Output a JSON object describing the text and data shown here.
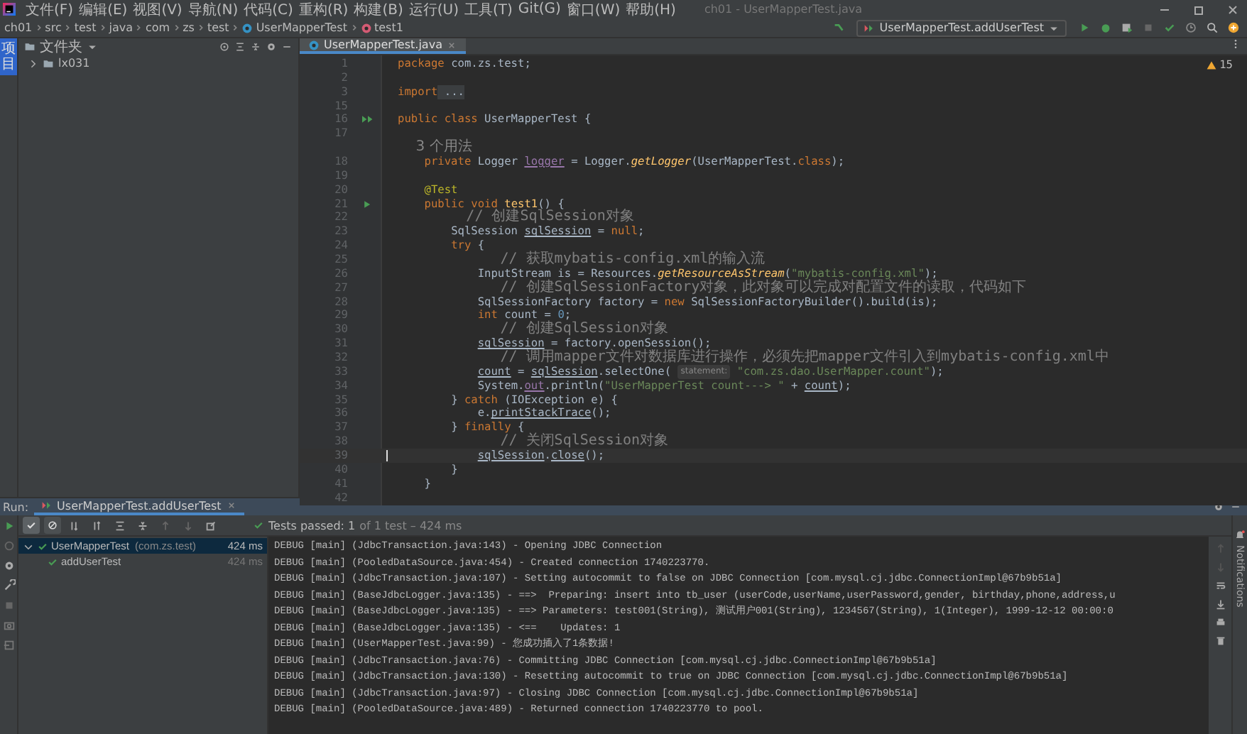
{
  "menubar": {
    "items": [
      "文件(F)",
      "编辑(E)",
      "视图(V)",
      "导航(N)",
      "代码(C)",
      "重构(R)",
      "构建(B)",
      "运行(U)",
      "工具(T)",
      "Git(G)",
      "窗口(W)",
      "帮助(H)"
    ],
    "title": "ch01 - UserMapperTest.java"
  },
  "breadcrumbs": [
    {
      "label": "ch01",
      "kind": "folder"
    },
    {
      "label": "src",
      "kind": "folder"
    },
    {
      "label": "test",
      "kind": "folder"
    },
    {
      "label": "java",
      "kind": "folder"
    },
    {
      "label": "com",
      "kind": "folder"
    },
    {
      "label": "zs",
      "kind": "folder"
    },
    {
      "label": "test",
      "kind": "folder"
    },
    {
      "label": "UserMapperTest",
      "kind": "class"
    },
    {
      "label": "test1",
      "kind": "method"
    }
  ],
  "run_config": "UserMapperTest.addUserTest",
  "side_tool": {
    "label": "项目",
    "selected": true
  },
  "project": {
    "title": "文件夹",
    "tree": [
      {
        "label": "lx031",
        "expanded": false
      }
    ]
  },
  "editor": {
    "tabs": [
      {
        "label": "UserMapperTest.java",
        "selected": true
      }
    ],
    "warnings": "15",
    "lines": [
      {
        "num": "1",
        "tokens": [
          {
            "t": "package",
            "kind": "kw"
          },
          {
            "t": " com.zs.test;",
            "kind": "plain"
          }
        ]
      },
      {
        "num": "2"
      },
      {
        "num": "3",
        "tokens": [
          {
            "t": "import",
            "kind": "kw"
          },
          {
            "t": " ...",
            "kind": "fold"
          }
        ]
      },
      {
        "num": "15"
      },
      {
        "num": "16",
        "kind": "run-class",
        "tokens": [
          {
            "t": "public class ",
            "kind": "kw"
          },
          {
            "t": "UserMapperTest {",
            "kind": "plain"
          }
        ]
      },
      {
        "num": "17"
      },
      {
        "tokens": [
          {
            "t": "    3 个用法",
            "kind": "usage"
          }
        ]
      },
      {
        "num": "18",
        "tokens": [
          {
            "t": "    private ",
            "kind": "kw"
          },
          {
            "t": "Logger ",
            "kind": "plain"
          },
          {
            "t": "logger",
            "kind": "field"
          },
          {
            "t": " = Logger.",
            "kind": "plain"
          },
          {
            "t": "getLogger",
            "kind": "static"
          },
          {
            "t": "(UserMapperTest.",
            "kind": "plain"
          },
          {
            "t": "class",
            "kind": "kw"
          },
          {
            "t": ");",
            "kind": "plain"
          }
        ]
      },
      {
        "num": "19"
      },
      {
        "num": "20",
        "tokens": [
          {
            "t": "    @Test",
            "kind": "ann"
          }
        ]
      },
      {
        "num": "21",
        "kind": "run",
        "tokens": [
          {
            "t": "    public void ",
            "kind": "kw"
          },
          {
            "t": "test1",
            "kind": "method"
          },
          {
            "t": "() {",
            "kind": "plain"
          }
        ]
      },
      {
        "num": "22",
        "tokens": [
          {
            "t": "        // 创建SqlSession对象",
            "kind": "comment"
          }
        ]
      },
      {
        "num": "23",
        "tokens": [
          {
            "t": "        SqlSession ",
            "kind": "plain"
          },
          {
            "t": "sqlSession",
            "kind": "var"
          },
          {
            "t": " = ",
            "kind": "plain"
          },
          {
            "t": "null",
            "kind": "kw"
          },
          {
            "t": ";",
            "kind": "plain"
          }
        ]
      },
      {
        "num": "24",
        "tokens": [
          {
            "t": "        try ",
            "kind": "kw"
          },
          {
            "t": "{",
            "kind": "plain"
          }
        ]
      },
      {
        "num": "25",
        "tokens": [
          {
            "t": "            // 获取mybatis-config.xml的输入流",
            "kind": "comment"
          }
        ]
      },
      {
        "num": "26",
        "tokens": [
          {
            "t": "            InputStream is = Resources.",
            "kind": "plain"
          },
          {
            "t": "getResourceAsStream",
            "kind": "static"
          },
          {
            "t": "(",
            "kind": "plain"
          },
          {
            "t": "\"mybatis-config.xml\"",
            "kind": "str"
          },
          {
            "t": ");",
            "kind": "plain"
          }
        ]
      },
      {
        "num": "27",
        "tokens": [
          {
            "t": "            // 创建SqlSessionFactory对象，此对象可以完成对配置文件的读取，代码如下",
            "kind": "comment"
          }
        ]
      },
      {
        "num": "28",
        "tokens": [
          {
            "t": "            SqlSessionFactory factory = ",
            "kind": "plain"
          },
          {
            "t": "new ",
            "kind": "kw"
          },
          {
            "t": "SqlSessionFactoryBuilder().build(is);",
            "kind": "plain"
          }
        ]
      },
      {
        "num": "29",
        "tokens": [
          {
            "t": "            int ",
            "kind": "kw"
          },
          {
            "t": "count = ",
            "kind": "plain"
          },
          {
            "t": "0",
            "kind": "number"
          },
          {
            "t": ";",
            "kind": "plain"
          }
        ]
      },
      {
        "num": "30",
        "tokens": [
          {
            "t": "            // 创建SqlSession对象",
            "kind": "comment"
          }
        ]
      },
      {
        "num": "31",
        "tokens": [
          {
            "t": "            sqlSession",
            "kind": "var"
          },
          {
            "t": " = factory.openSession();",
            "kind": "plain"
          }
        ]
      },
      {
        "num": "32",
        "tokens": [
          {
            "t": "            // 调用mapper文件对数据库进行操作，必须先把mapper文件引入到mybatis-config.xml中",
            "kind": "comment"
          }
        ]
      },
      {
        "num": "33",
        "tokens": [
          {
            "t": "            count",
            "kind": "var"
          },
          {
            "t": " = ",
            "kind": "plain"
          },
          {
            "t": "sqlSession",
            "kind": "var"
          },
          {
            "t": ".selectOne( ",
            "kind": "plain"
          },
          {
            "t": "statement:",
            "kind": "hint"
          },
          {
            "t": " \"com.zs.dao.UserMapper.count\"",
            "kind": "str"
          },
          {
            "t": ");",
            "kind": "plain"
          }
        ]
      },
      {
        "num": "34",
        "tokens": [
          {
            "t": "            System.",
            "kind": "plain"
          },
          {
            "t": "out",
            "kind": "field"
          },
          {
            "t": ".println(",
            "kind": "plain"
          },
          {
            "t": "\"UserMapperTest count---> \"",
            "kind": "str"
          },
          {
            "t": " + ",
            "kind": "plain"
          },
          {
            "t": "count",
            "kind": "var"
          },
          {
            "t": ");",
            "kind": "plain"
          }
        ]
      },
      {
        "num": "35",
        "tokens": [
          {
            "t": "        } ",
            "kind": "plain"
          },
          {
            "t": "catch ",
            "kind": "kw"
          },
          {
            "t": "(IOException e) {",
            "kind": "plain"
          }
        ]
      },
      {
        "num": "36",
        "tokens": [
          {
            "t": "            e.",
            "kind": "plain"
          },
          {
            "t": "printStackTrace",
            "kind": "var"
          },
          {
            "t": "();",
            "kind": "plain"
          }
        ]
      },
      {
        "num": "37",
        "tokens": [
          {
            "t": "        } ",
            "kind": "plain"
          },
          {
            "t": "finally ",
            "kind": "kw"
          },
          {
            "t": "{",
            "kind": "plain"
          }
        ]
      },
      {
        "num": "38",
        "tokens": [
          {
            "t": "            // 关闭SqlSession对象",
            "kind": "comment"
          }
        ]
      },
      {
        "num": "39",
        "current": true,
        "tokens": [
          {
            "t": "            sqlSession",
            "kind": "var"
          },
          {
            "t": ".",
            "kind": "plain"
          },
          {
            "t": "close",
            "kind": "var"
          },
          {
            "t": "();",
            "kind": "plain"
          }
        ]
      },
      {
        "num": "40",
        "tokens": [
          {
            "t": "        }",
            "kind": "plain"
          }
        ]
      },
      {
        "num": "41",
        "tokens": [
          {
            "t": "    }",
            "kind": "plain"
          }
        ]
      },
      {
        "num": "42"
      }
    ]
  },
  "run": {
    "label": "Run:",
    "tabs": [
      {
        "label": "UserMapperTest.addUserTest",
        "selected": true
      }
    ],
    "status": {
      "label": "Tests passed: 1",
      "detail": "of 1 test – 424 ms"
    },
    "tree": [
      {
        "label": "UserMapperTest",
        "package": "(com.zs.test)",
        "time": "424 ms",
        "passed": true,
        "selected": true,
        "children": [
          {
            "label": "addUserTest",
            "time": "424 ms",
            "passed": true,
            "selected": false
          }
        ]
      }
    ],
    "console": [
      "DEBUG [main] (JdbcTransaction.java:143) - Opening JDBC Connection",
      "DEBUG [main] (PooledDataSource.java:454) - Created connection 1740223770.",
      "DEBUG [main] (JdbcTransaction.java:107) - Setting autocommit to false on JDBC Connection [com.mysql.cj.jdbc.ConnectionImpl@67b9b51a]",
      "DEBUG [main] (BaseJdbcLogger.java:135) - ==>  Preparing: insert into tb_user (userCode,userName,userPassword,gender, birthday,phone,address,u",
      "DEBUG [main] (BaseJdbcLogger.java:135) - ==> Parameters: test001(String), 测试用户001(String), 1234567(String), 1(Integer), 1999-12-12 00:00:0",
      "DEBUG [main] (BaseJdbcLogger.java:135) - <==    Updates: 1",
      "DEBUG [main] (UserMapperTest.java:99) - 您成功插入了1条数据!",
      "DEBUG [main] (JdbcTransaction.java:76) - Committing JDBC Connection [com.mysql.cj.jdbc.ConnectionImpl@67b9b51a]",
      "DEBUG [main] (JdbcTransaction.java:130) - Resetting autocommit to true on JDBC Connection [com.mysql.cj.jdbc.ConnectionImpl@67b9b51a]",
      "DEBUG [main] (JdbcTransaction.java:97) - Closing JDBC Connection [com.mysql.cj.jdbc.ConnectionImpl@67b9b51a]",
      "DEBUG [main] (PooledDataSource.java:489) - Returned connection 1740223770 to pool."
    ]
  },
  "notifications": "Notifications"
}
